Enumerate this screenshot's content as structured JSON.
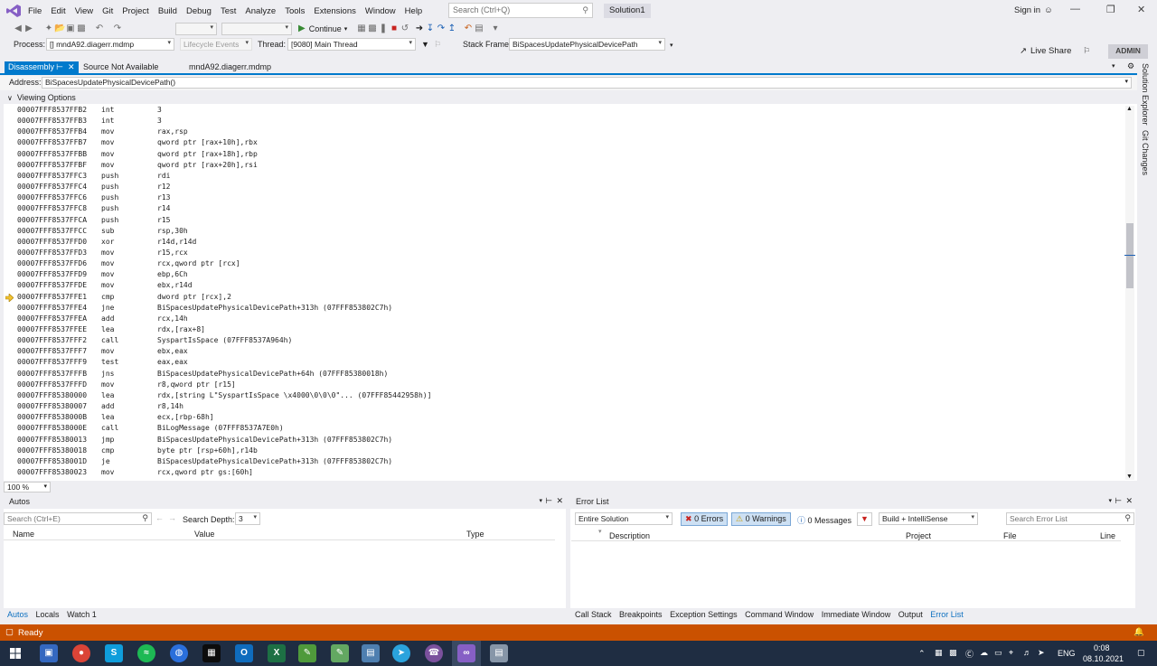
{
  "menu": [
    "File",
    "Edit",
    "View",
    "Git",
    "Project",
    "Build",
    "Debug",
    "Test",
    "Analyze",
    "Tools",
    "Extensions",
    "Window",
    "Help"
  ],
  "search_placeholder": "Search (Ctrl+Q)",
  "solution_name": "Solution1",
  "sign_in": "Sign in",
  "live_share": "Live Share",
  "admin": "ADMIN",
  "toolbar": {
    "continue": "Continue",
    "process_label": "Process:",
    "process_value": "[] mndA92.diagerr.mdmp",
    "lifecycle_events": "Lifecycle Events",
    "thread_label": "Thread:",
    "thread_value": "[9080] Main Thread",
    "stack_frame_label": "Stack Frame:",
    "stack_frame_value": "BiSpacesUpdatePhysicalDevicePath"
  },
  "tabs": [
    {
      "label": "Disassembly"
    },
    {
      "label": "Source Not Available"
    },
    {
      "label": "mndA92.diagerr.mdmp"
    }
  ],
  "address_label": "Address:",
  "address_value": "BiSpacesUpdatePhysicalDevicePath()",
  "viewing_options": "Viewing Options",
  "disasm": [
    {
      "addr": "00007FFF8537FFB2",
      "mn": "int",
      "op": "3"
    },
    {
      "addr": "00007FFF8537FFB3",
      "mn": "int",
      "op": "3"
    },
    {
      "addr": "00007FFF8537FFB4",
      "mn": "mov",
      "op": "rax,rsp"
    },
    {
      "addr": "00007FFF8537FFB7",
      "mn": "mov",
      "op": "qword ptr [rax+10h],rbx"
    },
    {
      "addr": "00007FFF8537FFBB",
      "mn": "mov",
      "op": "qword ptr [rax+18h],rbp"
    },
    {
      "addr": "00007FFF8537FFBF",
      "mn": "mov",
      "op": "qword ptr [rax+20h],rsi"
    },
    {
      "addr": "00007FFF8537FFC3",
      "mn": "push",
      "op": "rdi"
    },
    {
      "addr": "00007FFF8537FFC4",
      "mn": "push",
      "op": "r12"
    },
    {
      "addr": "00007FFF8537FFC6",
      "mn": "push",
      "op": "r13"
    },
    {
      "addr": "00007FFF8537FFC8",
      "mn": "push",
      "op": "r14"
    },
    {
      "addr": "00007FFF8537FFCA",
      "mn": "push",
      "op": "r15"
    },
    {
      "addr": "00007FFF8537FFCC",
      "mn": "sub",
      "op": "rsp,30h"
    },
    {
      "addr": "00007FFF8537FFD0",
      "mn": "xor",
      "op": "r14d,r14d"
    },
    {
      "addr": "00007FFF8537FFD3",
      "mn": "mov",
      "op": "r15,rcx"
    },
    {
      "addr": "00007FFF8537FFD6",
      "mn": "mov",
      "op": "rcx,qword ptr [rcx]"
    },
    {
      "addr": "00007FFF8537FFD9",
      "mn": "mov",
      "op": "ebp,6Ch"
    },
    {
      "addr": "00007FFF8537FFDE",
      "mn": "mov",
      "op": "ebx,r14d"
    },
    {
      "addr": "00007FFF8537FFE1",
      "mn": "cmp",
      "op": "dword ptr [rcx],2"
    },
    {
      "addr": "00007FFF8537FFE4",
      "mn": "jne",
      "op": "BiSpacesUpdatePhysicalDevicePath+313h (07FFF853802C7h)"
    },
    {
      "addr": "00007FFF8537FFEA",
      "mn": "add",
      "op": "rcx,14h"
    },
    {
      "addr": "00007FFF8537FFEE",
      "mn": "lea",
      "op": "rdx,[rax+8]"
    },
    {
      "addr": "00007FFF8537FFF2",
      "mn": "call",
      "op": "SyspartIsSpace (07FFF8537A964h)"
    },
    {
      "addr": "00007FFF8537FFF7",
      "mn": "mov",
      "op": "ebx,eax"
    },
    {
      "addr": "00007FFF8537FFF9",
      "mn": "test",
      "op": "eax,eax"
    },
    {
      "addr": "00007FFF8537FFFB",
      "mn": "jns",
      "op": "BiSpacesUpdatePhysicalDevicePath+64h (07FFF85380018h)"
    },
    {
      "addr": "00007FFF8537FFFD",
      "mn": "mov",
      "op": "r8,qword ptr [r15]"
    },
    {
      "addr": "00007FFF85380000",
      "mn": "lea",
      "op": "rdx,[string L\"SyspartIsSpace \\x4000\\0\\0\\0\"... (07FFF85442958h)]"
    },
    {
      "addr": "00007FFF85380007",
      "mn": "add",
      "op": "r8,14h"
    },
    {
      "addr": "00007FFF8538000B",
      "mn": "lea",
      "op": "ecx,[rbp-68h]"
    },
    {
      "addr": "00007FFF8538000E",
      "mn": "call",
      "op": "BiLogMessage (07FFF8537A7E0h)"
    },
    {
      "addr": "00007FFF85380013",
      "mn": "jmp",
      "op": "BiSpacesUpdatePhysicalDevicePath+313h (07FFF853802C7h)"
    },
    {
      "addr": "00007FFF85380018",
      "mn": "cmp",
      "op": "byte ptr [rsp+60h],r14b"
    },
    {
      "addr": "00007FFF8538001D",
      "mn": "je",
      "op": "BiSpacesUpdatePhysicalDevicePath+313h (07FFF853802C7h)"
    },
    {
      "addr": "00007FFF85380023",
      "mn": "mov",
      "op": "rcx,qword ptr gs:[60h]"
    }
  ],
  "zoom": "100 %",
  "side_tabs": [
    "Solution Explorer",
    "Git Changes"
  ],
  "autos": {
    "title": "Autos",
    "search_placeholder": "Search (Ctrl+E)",
    "search_depth_label": "Search Depth:",
    "search_depth_value": "3",
    "columns": [
      "Name",
      "Value",
      "Type"
    ],
    "bottom_tabs": [
      "Autos",
      "Locals",
      "Watch 1"
    ]
  },
  "error_list": {
    "title": "Error List",
    "scope": "Entire Solution",
    "errors": "0 Errors",
    "warnings": "0 Warnings",
    "messages": "0 Messages",
    "build_filter": "Build + IntelliSense",
    "search_placeholder": "Search Error List",
    "columns": [
      "Description",
      "Project",
      "File",
      "Line"
    ],
    "bottom_tabs": [
      "Call Stack",
      "Breakpoints",
      "Exception Settings",
      "Command Window",
      "Immediate Window",
      "Output",
      "Error List"
    ]
  },
  "status": "Ready",
  "taskbar": {
    "lang": "ENG",
    "time": "0:08",
    "date": "08.10.2021"
  }
}
